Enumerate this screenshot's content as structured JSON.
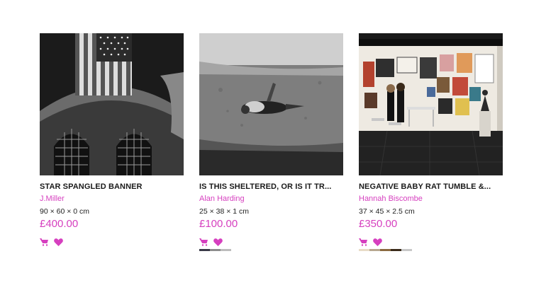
{
  "colors": {
    "accent": "#d63fbf",
    "title": "#1a1a1a"
  },
  "icons": {
    "cart": "cart-icon",
    "favourite": "heart-icon"
  },
  "artworks": [
    {
      "title": "STAR SPANGLED BANNER",
      "artist": "J.Miller",
      "dimensions": "90 × 60 × 0 cm",
      "price": "£400.00",
      "swatches": []
    },
    {
      "title": "IS THIS SHELTERED, OR IS IT TR...",
      "artist": "Alan Harding",
      "dimensions": "25 × 38 × 1 cm",
      "price": "£100.00",
      "swatches": [
        "#3a3a48",
        "#8d8d8d",
        "#bdbdbd"
      ]
    },
    {
      "title": "NEGATIVE BABY RAT TUMBLE &...",
      "artist": "Hannah Biscombe",
      "dimensions": "37 × 45 × 2.5 cm",
      "price": "£350.00",
      "swatches": [
        "#e8dcc8",
        "#b8a890",
        "#8a6a40",
        "#3a2a1a",
        "#c8c8c8"
      ]
    }
  ]
}
